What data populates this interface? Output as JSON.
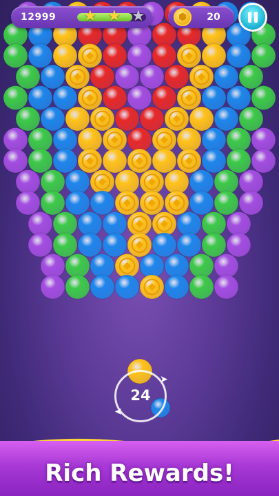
{
  "hud": {
    "score": "12999",
    "stars_earned": 2,
    "stars_total": 3,
    "progress": 0.8,
    "coins": "20",
    "coin_icon": "hexagon-coin-icon",
    "pause_icon": "pause-icon"
  },
  "shooter": {
    "moves_left": "24",
    "current_bubble": "yellow",
    "next_bubble": "blue"
  },
  "banner": {
    "text": "Rich Rewards!"
  },
  "colors": {
    "red": "#e62a2a",
    "yellow": "#ffc21a",
    "green": "#3ec94a",
    "blue": "#1f86ea",
    "purple": "#a34ee0",
    "coin": "#ffc21a",
    "accent_progress": "#6cc52a",
    "pause_button": "#1fb6d6"
  },
  "grid": {
    "legend": "R=red, Y=yellow, G=green, B=blue, P=purple, C=coin bubble, .=empty",
    "rows": [
      "PBYRRPRYBB",
      "GBYRRPRRYBG",
      "GBYCRPRCYBG",
      "GBCRPPRCBG",
      "GBBCRPRCBBG",
      "GBYCRRCYBG",
      "PGBYCRCYBGP",
      "PGBCYCYCBGP",
      "PGBCYCYBGP",
      "PGBBCCCBGP",
      "PGBBCCBGP",
      "PGBBCBBGP",
      "PGBCBBGP",
      "PGBBCBGP"
    ]
  }
}
